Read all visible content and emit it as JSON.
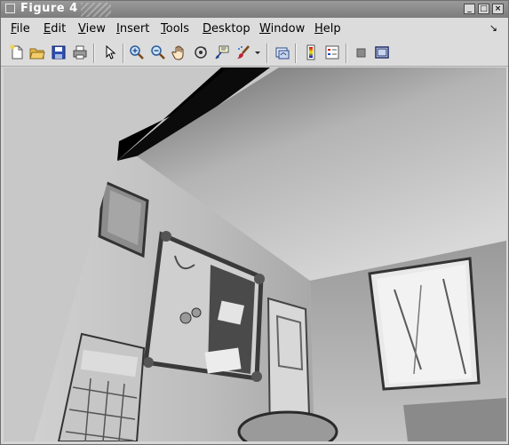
{
  "window": {
    "title": "Figure 4",
    "controls": {
      "minimize": "_",
      "maximize": "□",
      "close": "×"
    }
  },
  "menubar": {
    "items": [
      {
        "label": "File",
        "mnemonic": "F"
      },
      {
        "label": "Edit",
        "mnemonic": "E"
      },
      {
        "label": "View",
        "mnemonic": "V"
      },
      {
        "label": "Insert",
        "mnemonic": "I"
      },
      {
        "label": "Tools",
        "mnemonic": "T"
      },
      {
        "label": "Desktop",
        "mnemonic": "D"
      },
      {
        "label": "Window",
        "mnemonic": "W"
      },
      {
        "label": "Help",
        "mnemonic": "H"
      }
    ]
  },
  "toolbar": {
    "tools": [
      "new-figure-icon",
      "open-file-icon",
      "save-icon",
      "print-icon",
      "edit-plot-arrow-icon",
      "zoom-in-icon",
      "zoom-out-icon",
      "pan-hand-icon",
      "rotate-3d-icon",
      "data-cursor-icon",
      "brush-icon",
      "brush-dropdown-icon",
      "link-plot-icon",
      "insert-colorbar-icon",
      "insert-legend-icon",
      "hide-plot-tools-icon",
      "show-plot-tools-icon"
    ]
  },
  "canvas": {
    "content": "warped grayscale image"
  }
}
